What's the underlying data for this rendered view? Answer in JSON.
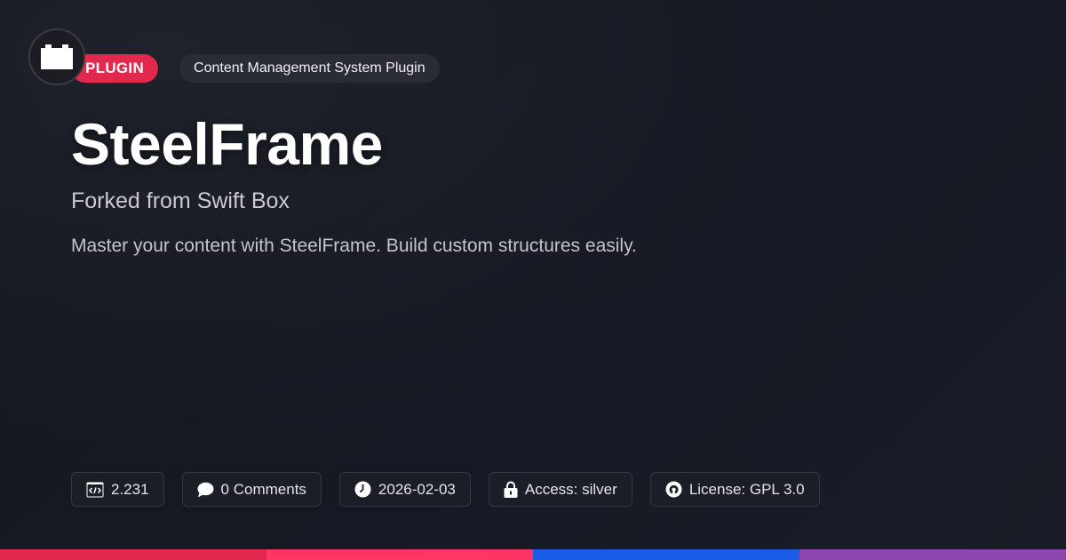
{
  "logo": {
    "icon": "block-icon"
  },
  "badges": {
    "type": "PLUGIN",
    "category": "Content Management System Plugin"
  },
  "title": "SteelFrame",
  "subtitle": "Forked from Swift Box",
  "description": "Master your content with SteelFrame. Build custom structures easily.",
  "meta": {
    "version": "2.231",
    "comments": "0 Comments",
    "date": "2026-02-03",
    "access": "Access: silver",
    "license": "License: GPL 3.0"
  },
  "colors": {
    "accent": "#e3284e",
    "stripe": [
      "#e3284e",
      "#ff3566",
      "#1a5ce6",
      "#8e44ad"
    ]
  }
}
